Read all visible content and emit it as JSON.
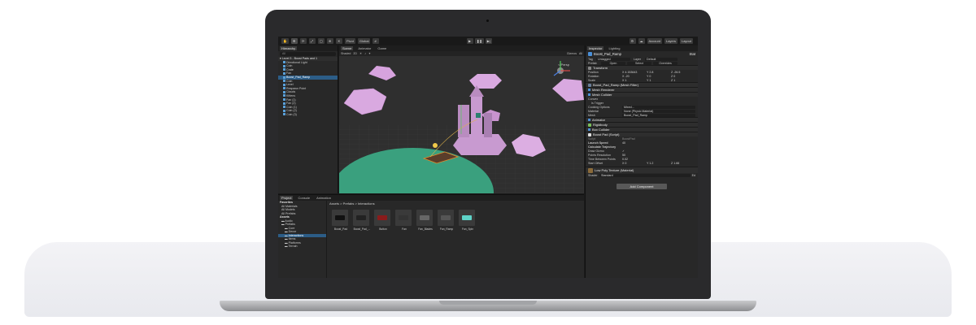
{
  "toolbar": {
    "pivot": "Pivot",
    "global": "Global",
    "account": "Account",
    "layers": "Layers",
    "layout": "Layout"
  },
  "hierarchy": {
    "tab": "Hierarchy",
    "search_placeholder": "All",
    "scene": "Level 3 - Boost Pads and 1",
    "items": [
      {
        "label": "Directional Light",
        "level": 1
      },
      {
        "label": "Coin",
        "level": 1
      },
      {
        "label": "Crate",
        "level": 1
      },
      {
        "label": "Fan",
        "level": 1
      },
      {
        "label": "Boost_Pad_Ramp",
        "level": 1,
        "selected": true
      },
      {
        "label": "Coin",
        "level": 1
      },
      {
        "label": "Level",
        "level": 1
      },
      {
        "label": "Respawn Point",
        "level": 1
      },
      {
        "label": "Clouds",
        "level": 1
      },
      {
        "label": "Kittens",
        "level": 1
      },
      {
        "label": "Fan (1)",
        "level": 1
      },
      {
        "label": "Fan (2)",
        "level": 1
      },
      {
        "label": "Coin (1)",
        "level": 1
      },
      {
        "label": "Coin (2)",
        "level": 1
      },
      {
        "label": "Coin (3)",
        "level": 1
      }
    ]
  },
  "scene": {
    "tabs": [
      "Scene",
      "Animator",
      "Game"
    ],
    "shading": "Shaded",
    "gizmos": "Gizmos",
    "all": "All",
    "persp": "< Persp"
  },
  "inspector": {
    "tabs": [
      "Inspector",
      "Lighting"
    ],
    "object_name": "Boost_Pad_Ramp",
    "static": "Stat",
    "tag_label": "Tag",
    "tag_value": "Untagged",
    "layer_label": "Layer",
    "layer_value": "Default",
    "prefab_label": "Prefab",
    "prefab_open": "Open",
    "prefab_select": "Select",
    "prefab_overrides": "Overrides",
    "transform": "Transform",
    "position_label": "Position",
    "position": [
      "X 4.153643",
      "Y 2.8",
      "Z -26.5"
    ],
    "rotation_label": "Rotation",
    "rotation": [
      "X -20",
      "Y 0",
      "Z 0"
    ],
    "scale_label": "Scale",
    "scale": [
      "X 1",
      "Y 1",
      "Z 1"
    ],
    "mesh_filter": "Boost_Pad_Ramp (Mesh Filter)",
    "mesh_renderer": "Mesh Renderer",
    "mesh_collider": "Mesh Collider",
    "convex_label": "Convex",
    "trigger_label": "Is Trigger",
    "cooking_label": "Cooking Options",
    "cooking_value": "Mixed...",
    "material_label": "Material",
    "material_value": "None (Physic Material)",
    "mesh_label": "Mesh",
    "mesh_value": "Boost_Pad_Ramp",
    "animator": "Animator",
    "rigidbody": "Rigidbody",
    "box_collider": "Box Collider",
    "boost_pad": "Boost Pad (Script)",
    "script_label": "Script",
    "script_value": "BoostPad",
    "launch_label": "Launch Speed",
    "launch_value": "40",
    "calc_label": "Calculate Trajectory",
    "draw_label": "Draw Gizmo",
    "points_label": "Points Resolution",
    "points_value": "50",
    "time_label": "Time Between Points",
    "time_value": "0.02",
    "start_label": "Start Offset",
    "start_value": [
      "X 0",
      "Y 1.2",
      "Z 1.66"
    ],
    "material_name": "Low Poly Texture (Material)",
    "shader_label": "Shader",
    "shader_value": "Standard",
    "edit": "Ed",
    "add_component": "Add Component"
  },
  "project": {
    "tabs": [
      "Project",
      "Console",
      "Animation"
    ],
    "favorites": "Favorites",
    "fav_items": [
      "All Materials",
      "All Models",
      "All Prefabs"
    ],
    "assets_label": "Assets",
    "folders": [
      {
        "label": "Audio",
        "level": 1
      },
      {
        "label": "Prefabs",
        "level": 1
      },
      {
        "label": "Core",
        "level": 2
      },
      {
        "label": "Decor",
        "level": 2
      },
      {
        "label": "Interactions",
        "level": 2,
        "selected": true
      },
      {
        "label": "Items",
        "level": 2
      },
      {
        "label": "Platforms",
        "level": 2
      },
      {
        "label": "Terrain",
        "level": 2
      }
    ],
    "breadcrumb": "Assets > Prefabs > Interactions",
    "assets": [
      "Boost_Pad",
      "Boost_Pad_...",
      "Button",
      "Fan",
      "Fan_Blades",
      "Fan_Ramp",
      "Fan_Spin"
    ]
  },
  "colors": {
    "selection": "#2c5d87",
    "cloud": "#d9a9e0",
    "ground": "#3aa07e"
  }
}
